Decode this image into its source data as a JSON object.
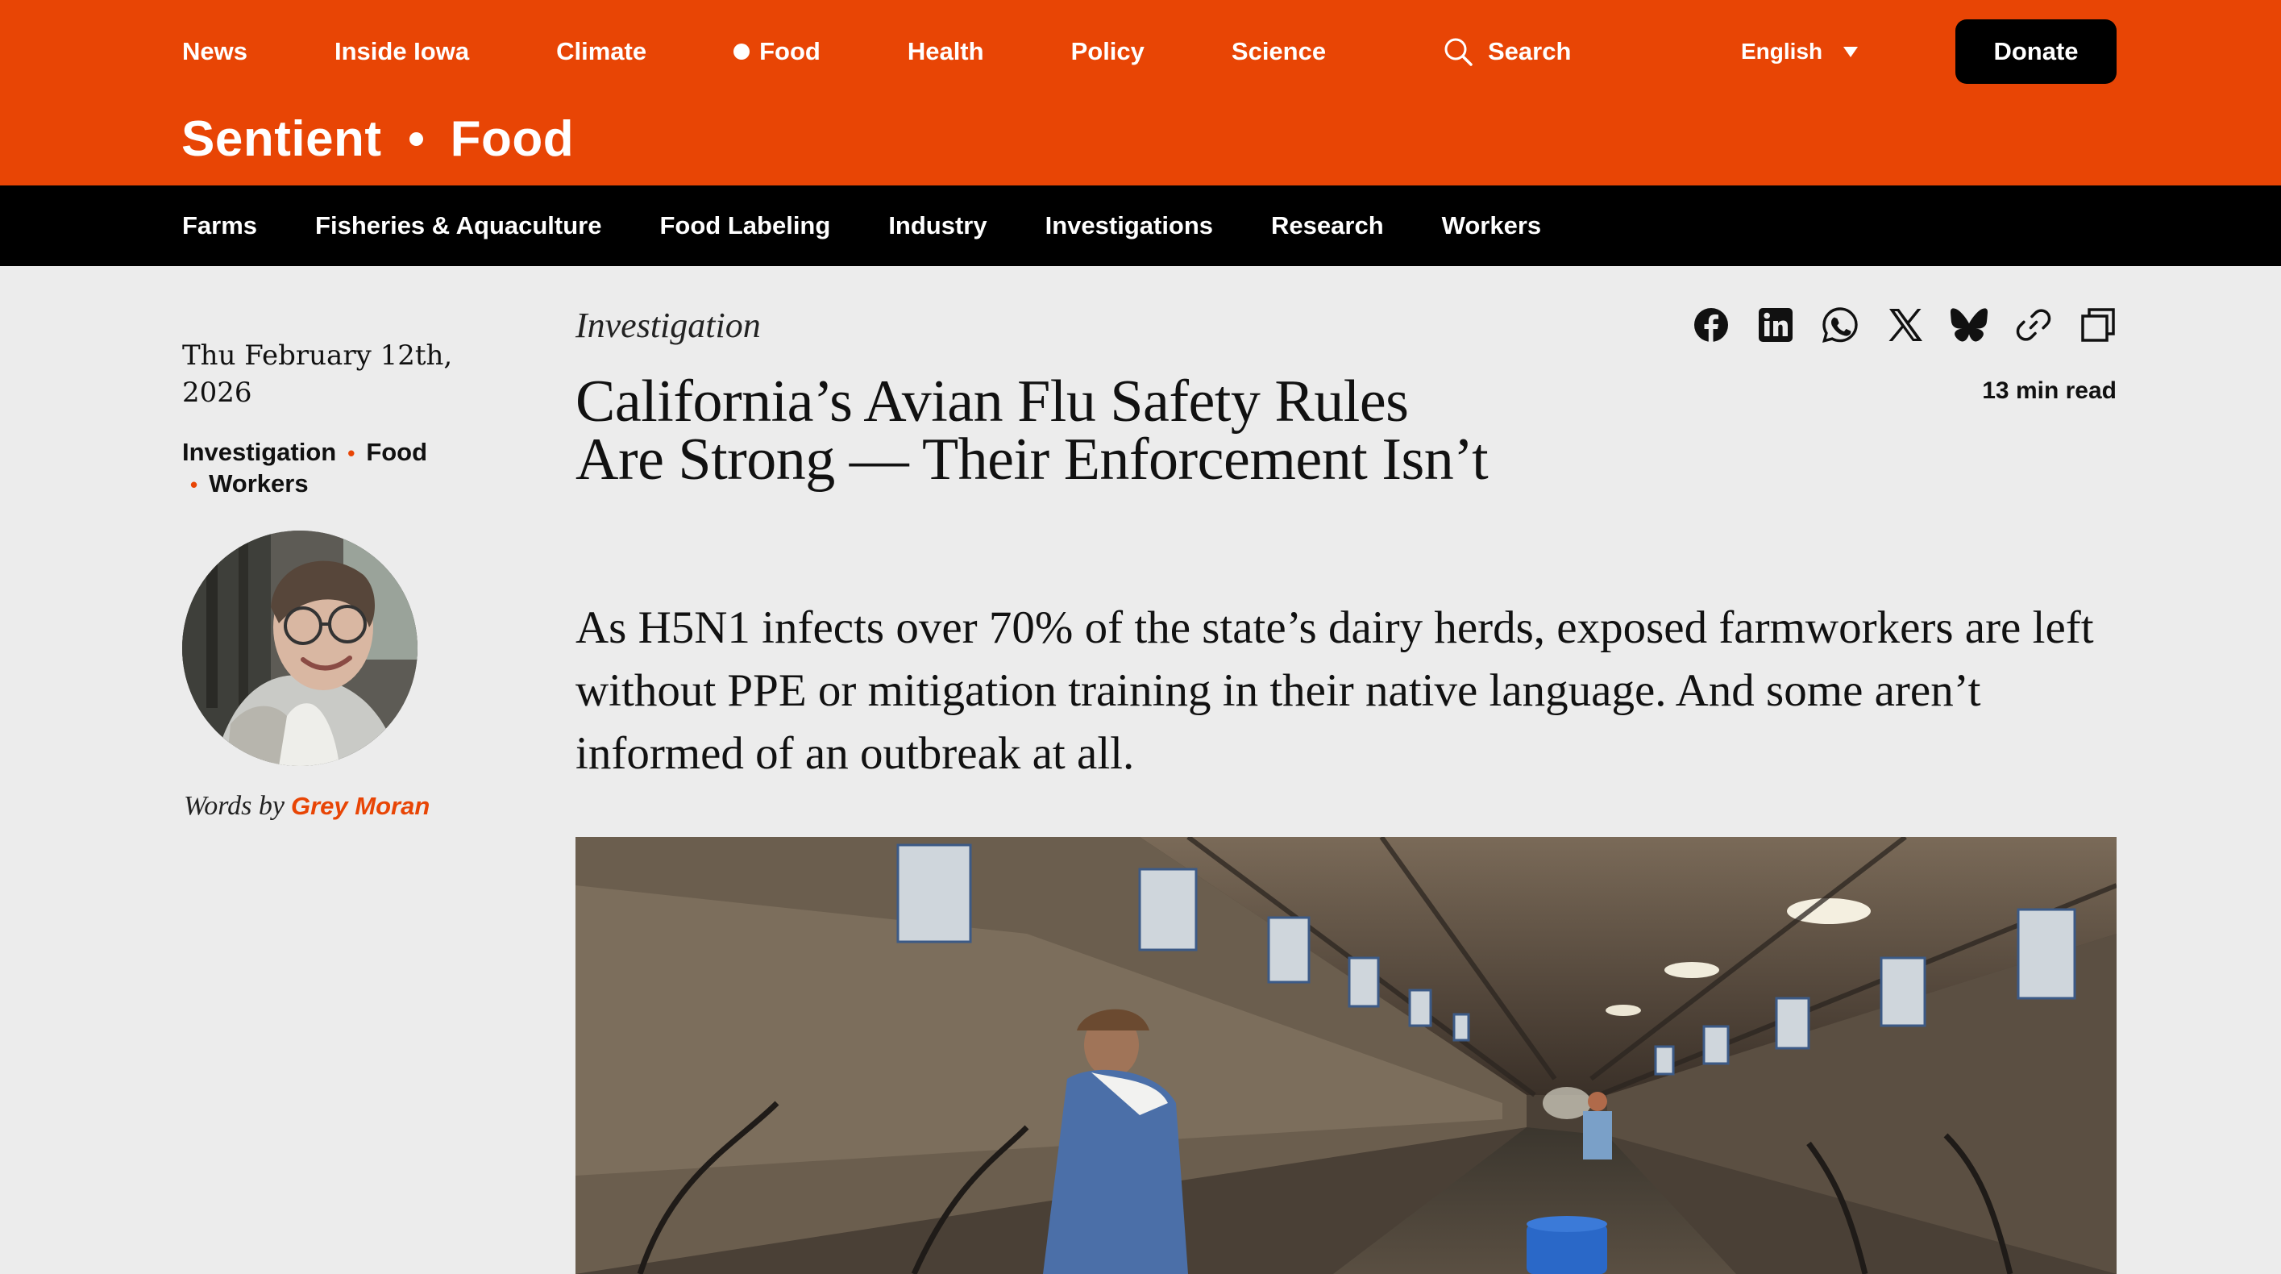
{
  "topnav": {
    "items": [
      {
        "label": "News"
      },
      {
        "label": "Inside Iowa"
      },
      {
        "label": "Climate"
      },
      {
        "label": "Food",
        "active": true
      },
      {
        "label": "Health"
      },
      {
        "label": "Policy"
      },
      {
        "label": "Science"
      }
    ],
    "search_label": "Search",
    "language": "English",
    "donate_label": "Donate"
  },
  "brand": {
    "site": "Sentient",
    "section": "Food"
  },
  "subnav": {
    "items": [
      "Farms",
      "Fisheries & Aquaculture",
      "Food Labeling",
      "Industry",
      "Investigations",
      "Research",
      "Workers"
    ]
  },
  "sidebar": {
    "date": "Thu February 12th, 2026",
    "tags": [
      "Investigation",
      "Food",
      "Workers"
    ],
    "byline_prefix": "Words by",
    "author": "Grey Moran"
  },
  "article": {
    "kicker": "Investigation",
    "headline": "California’s Avian Flu Safety Rules Are Strong — Their Enforcement Isn’t",
    "dek": "As H5N1 infects over 70% of the state’s dairy herds, exposed farmworkers are left without PPE or mitigation training in their native language. And some aren’t informed of an outbreak at all.",
    "read_time": "13 min read",
    "share_icons": [
      "facebook-icon",
      "linkedin-icon",
      "whatsapp-icon",
      "x-icon",
      "bluesky-icon",
      "link-icon",
      "copy-icon"
    ]
  },
  "colors": {
    "brand_orange": "#e84505",
    "nav_black": "#000000",
    "page_bg": "#ececec"
  }
}
